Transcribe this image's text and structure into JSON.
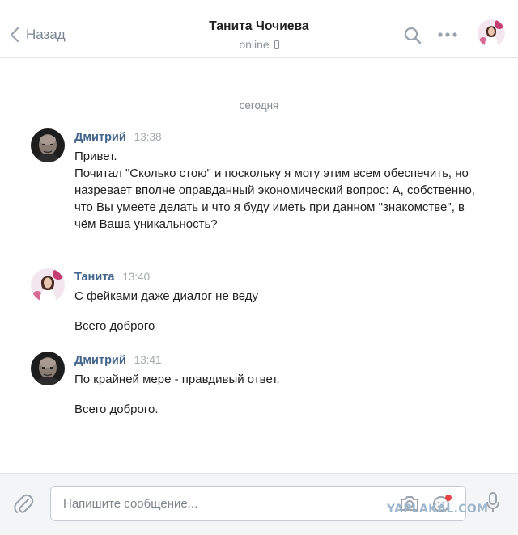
{
  "header": {
    "back_label": "Назад",
    "contact_name": "Танита Чочиева",
    "status": "online"
  },
  "date_separator": "сегодня",
  "messages": [
    {
      "author": "Дмитрий",
      "time": "13:38",
      "paragraphs": [
        "Привет.\nПочитал \"Сколько стою\" и поскольку я могу этим всем обеспечить, но назревает вполне оправданный экономический вопрос: А, собственно, что Вы умеете делать и что я буду иметь при данном \"знакомстве\", в чём Ваша уникальность?"
      ]
    },
    {
      "author": "Танита",
      "time": "13:40",
      "paragraphs": [
        "С фейками даже диалог не веду",
        "Всего доброго"
      ]
    },
    {
      "author": "Дмитрий",
      "time": "13:41",
      "paragraphs": [
        "По крайней мере - правдивый ответ.",
        "Всего доброго."
      ]
    }
  ],
  "composer": {
    "placeholder": "Напишите сообщение..."
  },
  "watermark": "YAPLAKAL.COM",
  "colors": {
    "author_link": "#42648b",
    "timestamp": "#a3a8ae",
    "header_icons": "#99a2ad"
  }
}
